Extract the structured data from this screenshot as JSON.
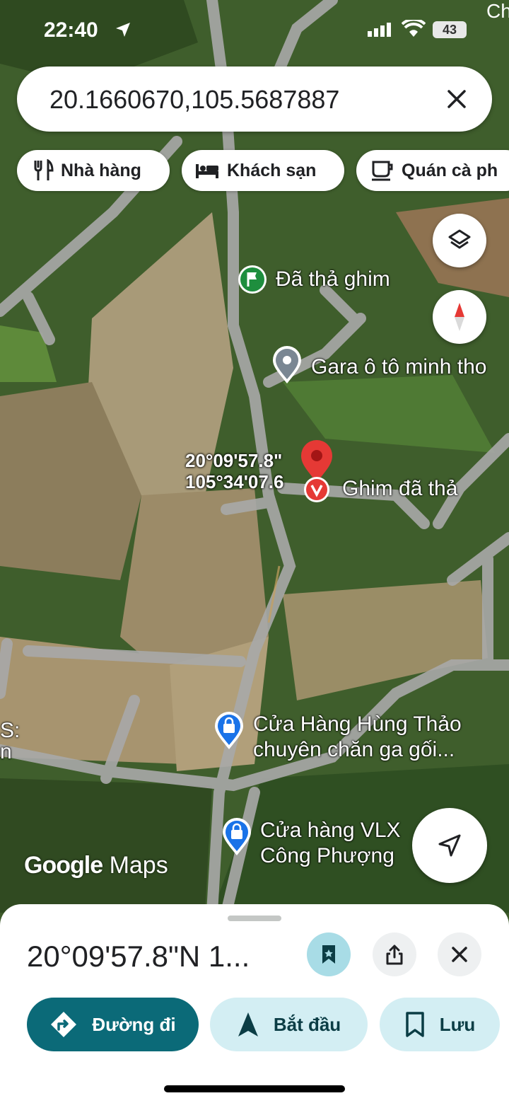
{
  "status_bar": {
    "time": "22:40",
    "battery": "43",
    "corner_text": "Ch"
  },
  "search": {
    "query": "20.1660670,105.5687887"
  },
  "chips": [
    {
      "label": "Nhà hàng",
      "icon": "restaurant-icon"
    },
    {
      "label": "Khách sạn",
      "icon": "hotel-icon"
    },
    {
      "label": "Quán cà ph",
      "icon": "coffee-icon"
    }
  ],
  "map": {
    "pois": [
      {
        "label": "Đã thả ghim",
        "icon": "flag-icon"
      },
      {
        "label": "Gara ô tô minh tho",
        "icon": "place-icon"
      },
      {
        "label": "Ghim đã thả",
        "icon": "pin-icon"
      },
      {
        "label_line1": "Cửa Hàng Hùng Thảo",
        "label_line2": "chuyên chăn ga gối...",
        "icon": "shopping-bag-icon"
      },
      {
        "label_line1": "Cửa hàng VLX",
        "label_line2": "Công Phượng",
        "icon": "shopping-bag-icon"
      }
    ],
    "pin_coord_line1": "20°09'57.8\"",
    "pin_coord_line2": "105°34'07.6",
    "edge_label_1": "S:",
    "edge_label_2": "n",
    "watermark_google": "Google",
    "watermark_maps": "Maps"
  },
  "sheet": {
    "title": "20°09'57.8\"N 1...",
    "actions": {
      "directions": "Đường đi",
      "start": "Bắt đầu",
      "save": "Lưu"
    }
  },
  "colors": {
    "accent_dark": "#0b6a78",
    "accent_light": "#d3eef3",
    "pin_red": "#e53935",
    "poi_blue": "#1a73e8"
  }
}
